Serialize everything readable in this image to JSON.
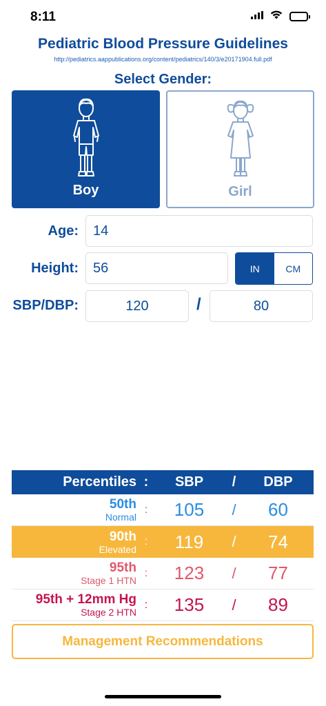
{
  "status": {
    "time": "8:11"
  },
  "app": {
    "title": "Pediatric Blood Pressure Guidelines",
    "link": "http://pediatrics.aappublications.org/content/pediatrics/140/3/e20171904.full.pdf",
    "gender_prompt": "Select Gender:"
  },
  "gender": {
    "boy_label": "Boy",
    "girl_label": "Girl",
    "selected": "Boy"
  },
  "form": {
    "age_label": "Age:",
    "age_value": "14",
    "height_label": "Height:",
    "height_value": "56",
    "unit_in": "IN",
    "unit_cm": "CM",
    "unit_selected": "IN",
    "bp_label": "SBP/DBP:",
    "sbp_value": "120",
    "bp_separator": "/",
    "dbp_value": "80"
  },
  "table": {
    "header": {
      "label": "Percentiles",
      "colon": ":",
      "sbp": "SBP",
      "slash": "/",
      "dbp": "DBP"
    },
    "rows": [
      {
        "title": "50th",
        "subtitle": "Normal",
        "colon": ":",
        "sbp": "105",
        "slash": "/",
        "dbp": "60"
      },
      {
        "title": "90th",
        "subtitle": "Elevated",
        "colon": ":",
        "sbp": "119",
        "slash": "/",
        "dbp": "74"
      },
      {
        "title": "95th",
        "subtitle": "Stage 1 HTN",
        "colon": ":",
        "sbp": "123",
        "slash": "/",
        "dbp": "77"
      },
      {
        "title": "95th + 12mm Hg",
        "subtitle": "Stage 2 HTN",
        "colon": ":",
        "sbp": "135",
        "slash": "/",
        "dbp": "89"
      }
    ]
  },
  "actions": {
    "management_label": "Management Recommendations"
  },
  "colors": {
    "brand_blue": "#0f4c9b",
    "normal": "#2a8de0",
    "elevated_bg": "#f6b73c",
    "stage1": "#e0586c",
    "stage2": "#c4154f",
    "accent_orange": "#f6b73c"
  },
  "icons": {
    "wifi": "wifi-icon",
    "battery": "battery-icon",
    "boy": "boy-figure-icon",
    "girl": "girl-figure-icon"
  }
}
